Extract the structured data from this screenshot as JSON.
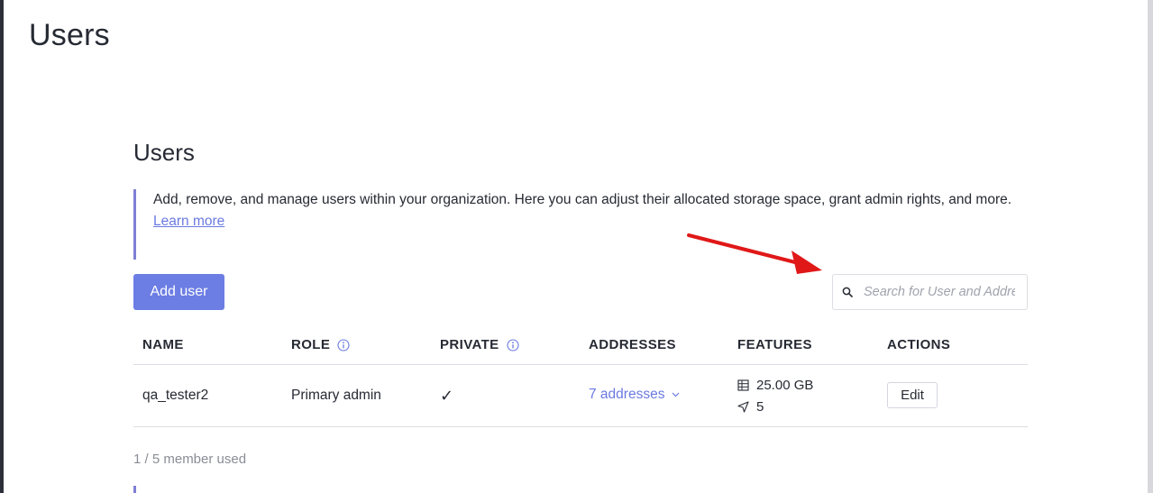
{
  "page": {
    "title": "Users"
  },
  "section": {
    "title": "Users",
    "description": "Add, remove, and manage users within your organization. Here you can adjust their allocated storage space, grant admin rights, and more.",
    "learn_more": "Learn more"
  },
  "toolbar": {
    "add_user_label": "Add user",
    "search_placeholder": "Search for User and Addresses"
  },
  "table": {
    "headers": {
      "name": "NAME",
      "role": "ROLE",
      "private": "PRIVATE",
      "addresses": "ADDRESSES",
      "features": "FEATURES",
      "actions": "ACTIONS"
    },
    "rows": [
      {
        "name": "qa_tester2",
        "role": "Primary admin",
        "private": "✓",
        "addresses": "7 addresses",
        "storage": "25.00 GB",
        "vpn": "5",
        "action": "Edit"
      }
    ]
  },
  "footer": {
    "member_usage": "1 / 5 member used"
  },
  "colors": {
    "accent": "#6c7de4",
    "link": "#6b7ae0",
    "annotation_arrow": "#e01818"
  }
}
